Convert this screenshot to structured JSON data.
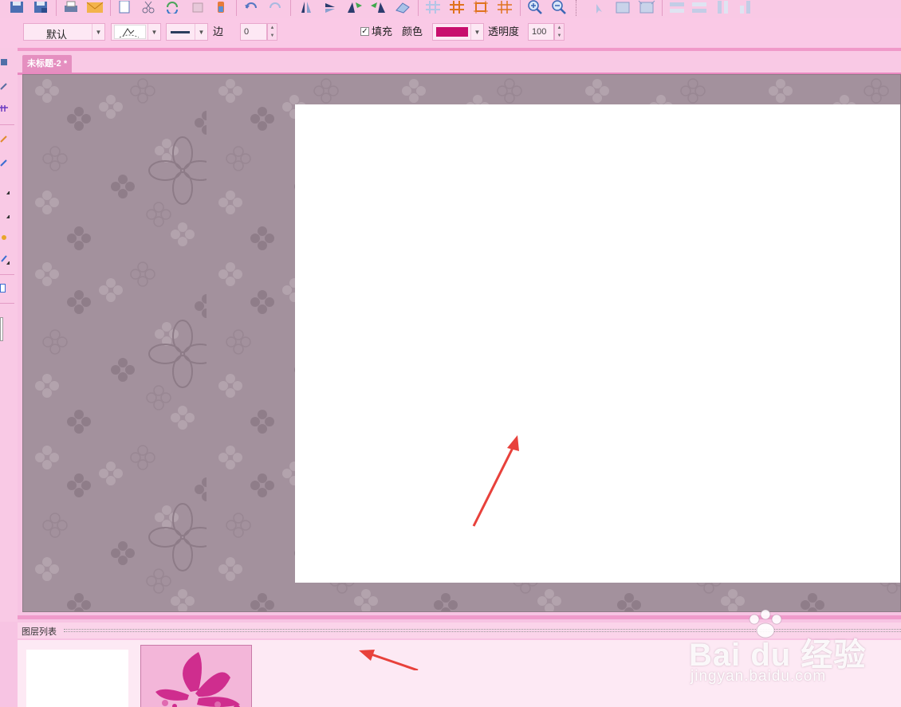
{
  "toolbar": {
    "style_preset": "默认",
    "border_label": "边",
    "border_value": "0",
    "fill_label": "填充",
    "fill_checked": true,
    "color_label": "颜色",
    "color_value": "#c8106e",
    "opacity_label": "透明度",
    "opacity_value": "100",
    "icons": [
      "save-icon",
      "save-as-icon",
      "print-icon",
      "email-icon",
      "copy-icon",
      "cut-icon",
      "paste-icon",
      "delete-icon",
      "clear-icon",
      "undo-icon",
      "redo-icon",
      "flip-vertical-icon",
      "flip-horizontal-icon",
      "rotate-left-icon",
      "rotate-right-icon",
      "eraser-icon",
      "grid-icon",
      "hash-grid-icon",
      "frame-icon",
      "hash-icon",
      "zoom-in-icon",
      "zoom-out-icon",
      "pointer-icon",
      "bring-front-icon",
      "send-back-icon",
      "align-top-icon",
      "align-bottom-icon",
      "align-left-icon",
      "align-right-icon"
    ]
  },
  "tab": {
    "title": "未标题-2 *"
  },
  "layers": {
    "title": "图层列表",
    "items": [
      "layer-blank",
      "layer-butterfly"
    ]
  },
  "watermark": {
    "brand": "Bai du 经验",
    "url": "jingyan.baidu.com"
  },
  "colors": {
    "chrome": "#f9c9e5",
    "accent": "#e58fc0",
    "workspace": "#a3919d",
    "arrow": "#e8413b"
  }
}
